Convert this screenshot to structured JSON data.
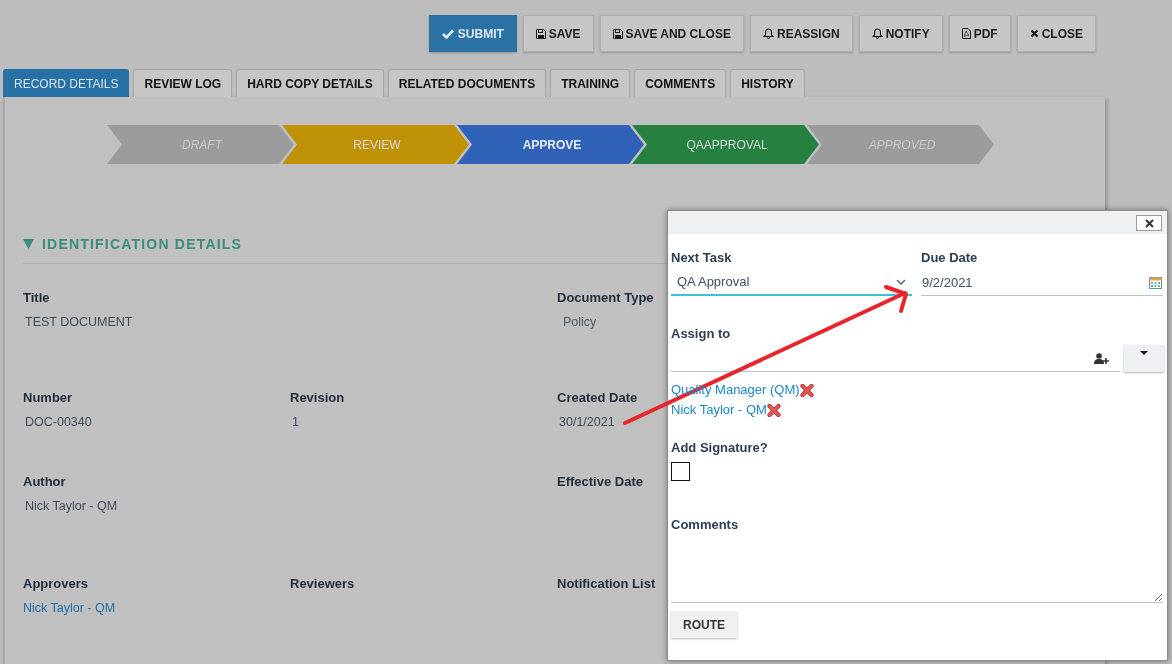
{
  "toolbar": {
    "buttons": [
      {
        "label": "SUBMIT",
        "kind": "submit"
      },
      {
        "label": "SAVE",
        "kind": "save"
      },
      {
        "label": "SAVE AND CLOSE",
        "kind": "save_close"
      },
      {
        "label": "REASSIGN",
        "kind": "reassign"
      },
      {
        "label": "NOTIFY",
        "kind": "notify"
      },
      {
        "label": "PDF",
        "kind": "pdf"
      },
      {
        "label": "CLOSE",
        "kind": "close"
      }
    ]
  },
  "tabs": [
    {
      "label": "RECORD DETAILS",
      "selected": true
    },
    {
      "label": "REVIEW LOG",
      "selected": false
    },
    {
      "label": "HARD COPY DETAILS",
      "selected": false
    },
    {
      "label": "RELATED DOCUMENTS",
      "selected": false
    },
    {
      "label": "TRAINING",
      "selected": false
    },
    {
      "label": "COMMENTS",
      "selected": false
    },
    {
      "label": "HISTORY",
      "selected": false
    }
  ],
  "workflow": {
    "steps": [
      {
        "label": "DRAFT",
        "kind": "terminal",
        "color": "#9b9b9b",
        "selected": false
      },
      {
        "label": "REVIEW",
        "kind": "stage",
        "color": "#bf9107",
        "selected": false
      },
      {
        "label": "APPROVE",
        "kind": "stage",
        "color": "#3062b8",
        "selected": true
      },
      {
        "label": "QAAPPROVAL",
        "kind": "stage",
        "color": "#268040",
        "selected": false
      },
      {
        "label": "APPROVED",
        "kind": "terminal",
        "color": "#9b9b9b",
        "selected": false
      }
    ]
  },
  "section": {
    "title": "IDENTIFICATION DETAILS",
    "expanded": true,
    "rows": [
      {
        "cells": [
          {
            "label": "Title",
            "value": "TEST DOCUMENT",
            "kind": "text"
          },
          null,
          {
            "label": "Document Type",
            "value": "Policy",
            "kind": "select"
          }
        ]
      },
      {
        "cells": [
          {
            "label": "Number",
            "value": "DOC-00340",
            "kind": "text"
          },
          {
            "label": "Revision",
            "value": "1",
            "kind": "text"
          },
          {
            "label": "Created Date",
            "value": "30/1/2021",
            "kind": "text"
          }
        ]
      },
      {
        "cells": [
          {
            "label": "Author",
            "value": "Nick Taylor - QM",
            "kind": "text"
          },
          null,
          {
            "label": "Effective Date"
          }
        ]
      },
      {
        "cells": [
          {
            "label": "Approvers",
            "value": "Nick Taylor - QM",
            "kind": "link"
          },
          {
            "label": "Reviewers"
          },
          {
            "label": "Notification List"
          }
        ]
      }
    ]
  },
  "dialog": {
    "next_task": {
      "label": "Next Task",
      "value": "QA Approval"
    },
    "due_date": {
      "label": "Due Date",
      "value": "9/2/2021"
    },
    "assign_to": {
      "label": "Assign to",
      "assignees": [
        {
          "name": "Quality Manager (QM)"
        },
        {
          "name": "Nick Taylor - QM"
        }
      ]
    },
    "signature": {
      "label": "Add Signature?",
      "checked": false
    },
    "comments": {
      "label": "Comments"
    },
    "route_button": {
      "label": "ROUTE"
    }
  }
}
